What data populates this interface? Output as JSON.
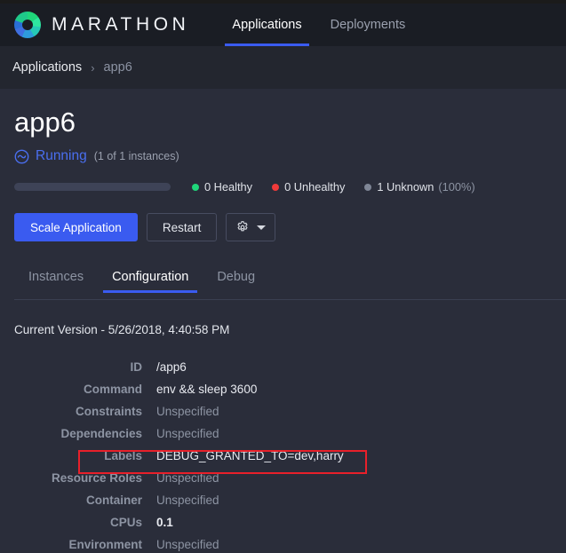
{
  "header": {
    "brand_name": "MARATHON",
    "logo_icon": "marathon-ring-logo",
    "nav": [
      {
        "label": "Applications",
        "active": true
      },
      {
        "label": "Deployments",
        "active": false
      }
    ]
  },
  "breadcrumb": {
    "root_label": "Applications",
    "separator": "›",
    "current_label": "app6"
  },
  "app": {
    "title": "app6",
    "status_icon": "running-circle-wave-icon",
    "status_label": "Running",
    "status_color": "#4a6ff0",
    "instances_summary": "(1 of 1 instances)",
    "health": {
      "legend": [
        {
          "label": "0 Healthy",
          "color": "#1fd67a",
          "pct": ""
        },
        {
          "label": "0 Unhealthy",
          "color": "#f03a3a",
          "pct": ""
        },
        {
          "label": "1 Unknown",
          "color": "#7f8696",
          "pct": "(100%)"
        }
      ]
    }
  },
  "actions": {
    "scale_label": "Scale Application",
    "restart_label": "Restart",
    "gear_icon": "gear-icon",
    "caret_icon": "chevron-down-icon"
  },
  "tabs": [
    {
      "label": "Instances",
      "active": false
    },
    {
      "label": "Configuration",
      "active": true
    },
    {
      "label": "Debug",
      "active": false
    }
  ],
  "configuration": {
    "version_line": "Current Version - 5/26/2018, 4:40:58 PM",
    "rows": [
      {
        "label": "ID",
        "value": "/app6",
        "style": "normal"
      },
      {
        "label": "Command",
        "value": "env && sleep 3600",
        "style": "normal"
      },
      {
        "label": "Constraints",
        "value": "Unspecified",
        "style": "unspecified"
      },
      {
        "label": "Dependencies",
        "value": "Unspecified",
        "style": "unspecified"
      },
      {
        "label": "Labels",
        "value": "DEBUG_GRANTED_TO=dev,harry",
        "style": "normal"
      },
      {
        "label": "Resource Roles",
        "value": "Unspecified",
        "style": "unspecified"
      },
      {
        "label": "Container",
        "value": "Unspecified",
        "style": "unspecified"
      },
      {
        "label": "CPUs",
        "value": "0.1",
        "style": "bold"
      },
      {
        "label": "Environment",
        "value": "Unspecified",
        "style": "unspecified"
      }
    ]
  },
  "annotation": {
    "highlight_target": "Labels",
    "highlight_color": "#e8202a"
  }
}
